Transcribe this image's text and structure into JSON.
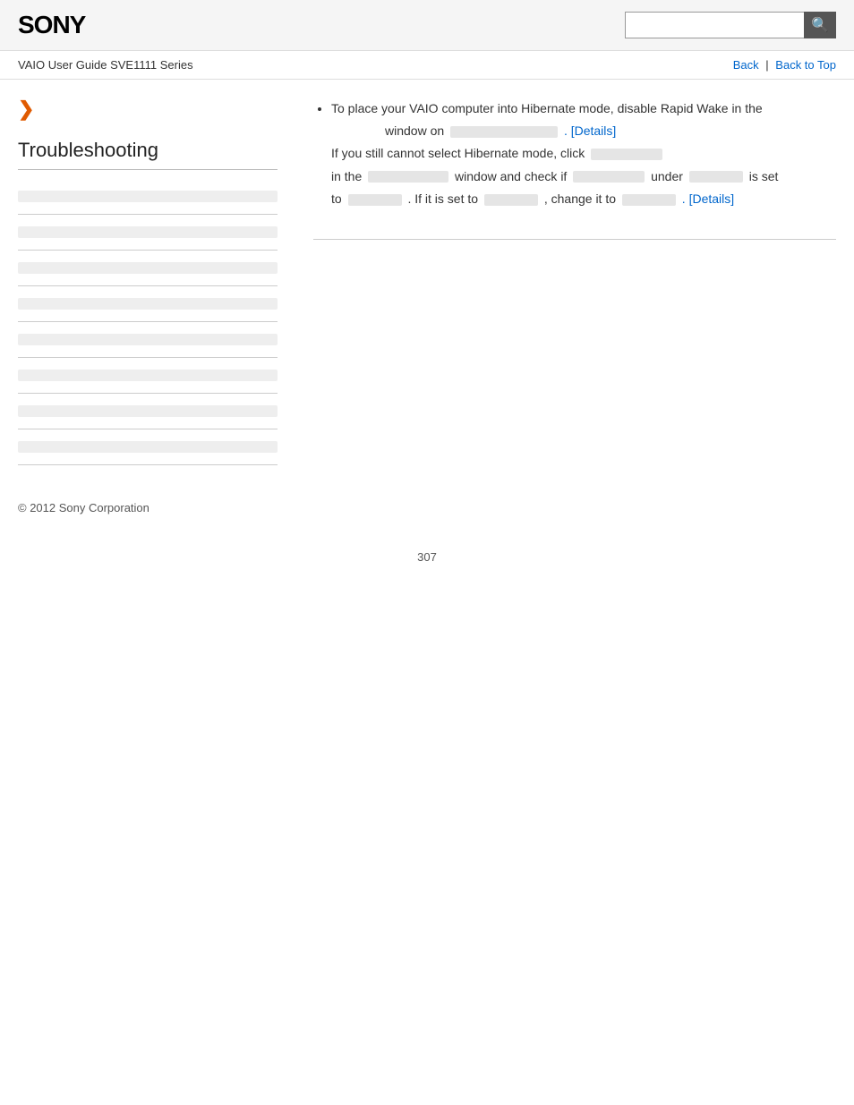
{
  "header": {
    "logo": "SONY",
    "search_placeholder": ""
  },
  "nav": {
    "guide_title": "VAIO User Guide SVE1111 Series",
    "back_label": "Back",
    "back_to_top_label": "Back to Top"
  },
  "sidebar": {
    "arrow": "❯",
    "section_title": "Troubleshooting",
    "items": [
      {
        "label": ""
      },
      {
        "label": ""
      },
      {
        "label": ""
      },
      {
        "label": ""
      },
      {
        "label": ""
      },
      {
        "label": ""
      },
      {
        "label": ""
      },
      {
        "label": ""
      }
    ]
  },
  "content": {
    "bullet1_text": "To place your VAIO computer into Hibernate mode, disable Rapid Wake in the",
    "bullet1_window": "window on",
    "bullet1_details_label": ". [Details]",
    "bullet1_details_href": "#",
    "line2_text": "If you still cannot select Hibernate mode, click",
    "line3_prefix": "in the",
    "line3_window": "window and check if",
    "line3_under": "under",
    "line3_isset": "is set",
    "line4_to": "to",
    "line4_ifset": ". If it is set to",
    "line4_changeit": ", change it to",
    "line4_details_label": ". [Details]",
    "line4_details_href": "#"
  },
  "footer": {
    "copyright": "© 2012 Sony Corporation"
  },
  "page_number": "307",
  "icons": {
    "search": "🔍"
  }
}
